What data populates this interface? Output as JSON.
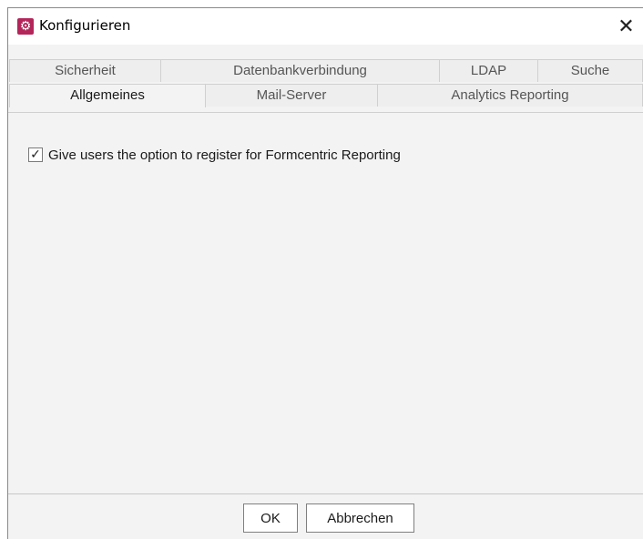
{
  "window": {
    "title": "Konfigurieren",
    "close_glyph": "✕",
    "icon": "gear-icon",
    "accent_color": "#b4265a"
  },
  "tabs": {
    "row_back": [
      {
        "label": "Sicherheit"
      },
      {
        "label": "Datenbankverbindung"
      },
      {
        "label": "LDAP"
      },
      {
        "label": "Suche"
      }
    ],
    "row_front": [
      {
        "label": "Allgemeines",
        "selected": true
      },
      {
        "label": "Mail-Server"
      },
      {
        "label": "Analytics Reporting"
      }
    ]
  },
  "content": {
    "register_option": {
      "label": "Give users the option to register for Formcentric Reporting",
      "checked": true,
      "check_glyph": "✓"
    }
  },
  "buttons": {
    "ok": "OK",
    "cancel": "Abbrechen"
  }
}
